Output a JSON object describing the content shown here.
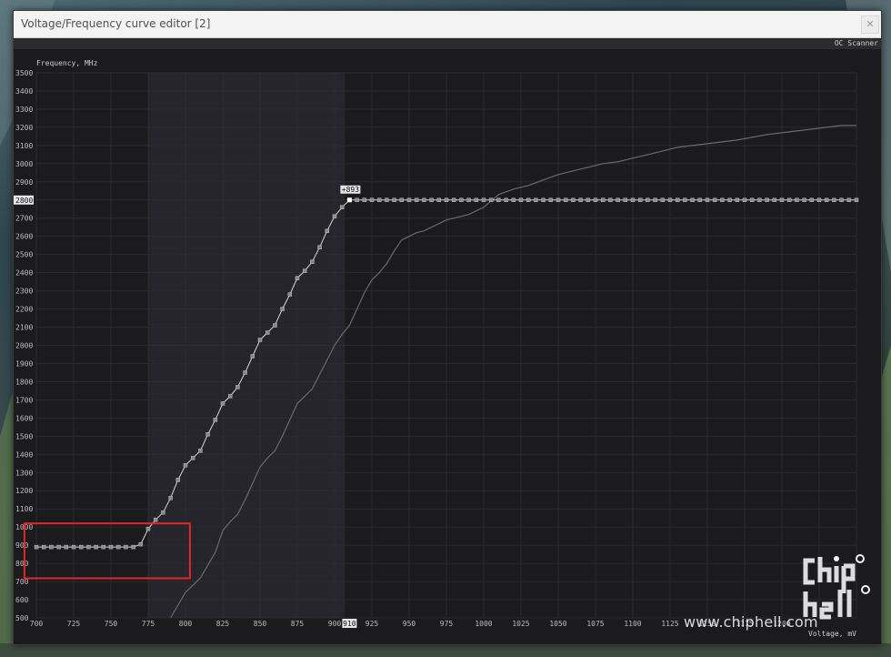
{
  "window": {
    "title": "Voltage/Frequency curve editor [2]",
    "close_glyph": "✕"
  },
  "toolbar": {
    "oc_scanner_label": "OC Scanner"
  },
  "chart_data": {
    "type": "line",
    "ylabel": "Frequency, MHz",
    "xlabel": "Voltage, mV",
    "xlim": [
      700,
      1250
    ],
    "ylim": [
      500,
      3500
    ],
    "x_ticks": [
      700,
      725,
      750,
      775,
      800,
      825,
      850,
      875,
      900,
      925,
      950,
      975,
      1000,
      1025,
      1050,
      1075,
      1100,
      1125,
      1150,
      1175,
      1200,
      1225,
      1250
    ],
    "y_ticks": [
      500,
      600,
      700,
      800,
      900,
      1000,
      1100,
      1200,
      1300,
      1400,
      1500,
      1600,
      1700,
      1800,
      1900,
      2000,
      2100,
      2200,
      2300,
      2400,
      2500,
      2600,
      2700,
      2800,
      2900,
      3000,
      3100,
      3200,
      3300,
      3400,
      3500
    ],
    "highlight_range_x": [
      775,
      907
    ],
    "selected_point": {
      "x": 910,
      "y": 2800,
      "x_label": "910",
      "y_label": "2800",
      "offset_label": "+893"
    },
    "series": [
      {
        "name": "",
        "style": "reference",
        "x": [
          790,
          795,
          800,
          805,
          810,
          815,
          820,
          825,
          830,
          835,
          840,
          845,
          850,
          855,
          860,
          865,
          870,
          875,
          880,
          885,
          890,
          895,
          900,
          905,
          910,
          915,
          920,
          925,
          930,
          935,
          940,
          945,
          950,
          955,
          960,
          965,
          970,
          975,
          980,
          985,
          990,
          995,
          1000,
          1010,
          1020,
          1030,
          1040,
          1050,
          1060,
          1070,
          1080,
          1090,
          1100,
          1110,
          1120,
          1130,
          1140,
          1150,
          1160,
          1170,
          1180,
          1190,
          1200,
          1210,
          1220,
          1230,
          1240,
          1250
        ],
        "y": [
          500,
          570,
          640,
          680,
          720,
          790,
          860,
          980,
          1030,
          1070,
          1150,
          1240,
          1330,
          1380,
          1420,
          1500,
          1590,
          1680,
          1720,
          1760,
          1840,
          1920,
          2000,
          2060,
          2110,
          2200,
          2290,
          2360,
          2400,
          2450,
          2520,
          2580,
          2600,
          2620,
          2630,
          2650,
          2670,
          2690,
          2700,
          2710,
          2720,
          2740,
          2760,
          2830,
          2860,
          2880,
          2910,
          2940,
          2960,
          2980,
          3000,
          3010,
          3030,
          3050,
          3070,
          3090,
          3100,
          3110,
          3120,
          3130,
          3145,
          3160,
          3170,
          3180,
          3190,
          3200,
          3210,
          3210
        ]
      },
      {
        "name": "",
        "style": "curve",
        "x": [
          700,
          705,
          710,
          715,
          720,
          725,
          730,
          735,
          740,
          745,
          750,
          755,
          760,
          765,
          770,
          775,
          780,
          785,
          790,
          795,
          800,
          805,
          810,
          815,
          820,
          825,
          830,
          835,
          840,
          845,
          850,
          855,
          860,
          865,
          870,
          875,
          880,
          885,
          890,
          895,
          900,
          905,
          910,
          915,
          920,
          925,
          930,
          935,
          940,
          945,
          950,
          955,
          960,
          965,
          970,
          975,
          980,
          985,
          990,
          995,
          1000,
          1005,
          1010,
          1015,
          1020,
          1025,
          1030,
          1035,
          1040,
          1045,
          1050,
          1055,
          1060,
          1065,
          1070,
          1075,
          1080,
          1085,
          1090,
          1095,
          1100,
          1105,
          1110,
          1115,
          1120,
          1125,
          1130,
          1135,
          1140,
          1145,
          1150,
          1155,
          1160,
          1165,
          1170,
          1175,
          1180,
          1185,
          1190,
          1195,
          1200,
          1205,
          1210,
          1215,
          1220,
          1225,
          1230,
          1235,
          1240,
          1245,
          1250
        ],
        "y": [
          890,
          890,
          890,
          890,
          890,
          890,
          890,
          890,
          890,
          890,
          890,
          890,
          890,
          890,
          905,
          990,
          1040,
          1080,
          1160,
          1260,
          1340,
          1380,
          1420,
          1510,
          1590,
          1680,
          1720,
          1770,
          1850,
          1940,
          2030,
          2070,
          2110,
          2200,
          2280,
          2370,
          2410,
          2460,
          2540,
          2630,
          2710,
          2760,
          2800,
          2800,
          2800,
          2800,
          2800,
          2800,
          2800,
          2800,
          2800,
          2800,
          2800,
          2800,
          2800,
          2800,
          2800,
          2800,
          2800,
          2800,
          2800,
          2800,
          2800,
          2800,
          2800,
          2800,
          2800,
          2800,
          2800,
          2800,
          2800,
          2800,
          2800,
          2800,
          2800,
          2800,
          2800,
          2800,
          2800,
          2800,
          2800,
          2800,
          2800,
          2800,
          2800,
          2800,
          2800,
          2800,
          2800,
          2800,
          2800,
          2800,
          2800,
          2800,
          2800,
          2800,
          2800,
          2800,
          2800,
          2800,
          2800,
          2800,
          2800,
          2800,
          2800,
          2800,
          2800,
          2800,
          2800,
          2800,
          2800
        ]
      }
    ]
  },
  "overlay": {
    "annotation_color": "#e0282a",
    "annotation_x_range": [
      692,
      803
    ],
    "annotation_y_range": [
      718,
      1020
    ]
  },
  "watermark": {
    "text": "www.chiphell.com",
    "logo_text": "chip hell"
  },
  "colors": {
    "curve": "#d8d8d8",
    "reference": "#6a6a6a",
    "background": "#1b1b1e",
    "highlight": "#25252b",
    "grid": "#2b2b30"
  }
}
